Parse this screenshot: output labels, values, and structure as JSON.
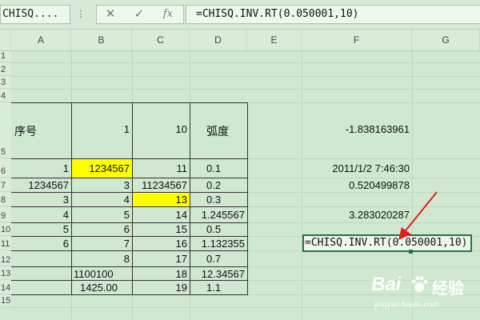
{
  "name_box": "CHISQ....",
  "formula_bar": {
    "content": "=CHISQ.INV.RT(0.050001,10)"
  },
  "columns": [
    "A",
    "B",
    "C",
    "D",
    "E",
    "F",
    "G"
  ],
  "rows": [
    "1",
    "2",
    "3",
    "4",
    "5",
    "6",
    "7",
    "8",
    "9",
    "10",
    "11",
    "12",
    "13",
    "14",
    "15"
  ],
  "header_row": {
    "a": "序号",
    "b": "1",
    "c": "10",
    "d": "弧度"
  },
  "cells": {
    "f5": "-1.838163961",
    "a6": "1",
    "b6": "1234567",
    "c6": "11",
    "d6": "0.1",
    "f6": "2011/1/2 7:46:30",
    "a7": "1234567",
    "b7": "3",
    "c7": "11234567",
    "d7": "0.2",
    "f7": "0.520499878",
    "a8": "3",
    "b8": "4",
    "c8": "13",
    "d8": "0.3",
    "a9": "4",
    "b9": "5",
    "c9": "14",
    "d9": "1.245567",
    "f9": "3.283020287",
    "a10": "5",
    "b10": "6",
    "c10": "15",
    "d10": "0.5",
    "a11": "6",
    "b11": "7",
    "c11": "16",
    "d11": "1.132355",
    "b12": "8",
    "c12": "17",
    "d12": "0.7",
    "b13": "1100100",
    "c13": "18",
    "d13": "12.34567",
    "b14": "1425.00",
    "c14": "19",
    "d14": "1.1"
  },
  "active_cell_formula": "=CHISQ.INV.RT(0.050001,10)",
  "highlight_color": "#ffff00",
  "accent_color": "#217346",
  "watermark": {
    "brand": "Bai",
    "suffix": "经验",
    "url": "jingyan.baidu.com"
  }
}
